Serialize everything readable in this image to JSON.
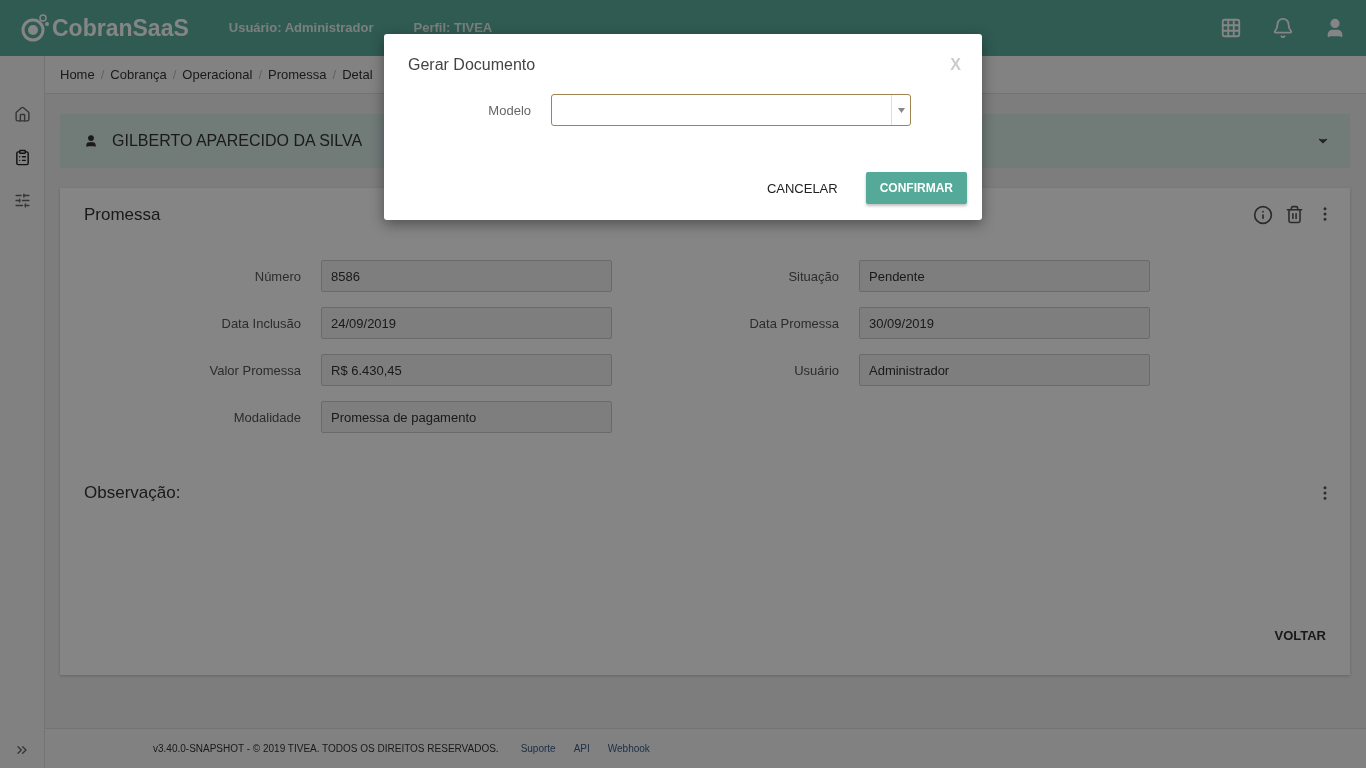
{
  "header": {
    "brand": "CobranSaaS",
    "user_label": "Usuário:",
    "user_value": "Administrador",
    "profile_label": "Perfil:",
    "profile_value": "TIVEA"
  },
  "breadcrumb": [
    "Home",
    "Cobrança",
    "Operacional",
    "Promessa",
    "Detal"
  ],
  "breadcrumb_separator": "/",
  "sidebar": {
    "items": [
      {
        "kind": "home",
        "selected": false
      },
      {
        "kind": "clipboard",
        "selected": true
      },
      {
        "kind": "sliders",
        "selected": false
      }
    ]
  },
  "person": {
    "name": "GILBERTO APARECIDO DA SILVA"
  },
  "card": {
    "title": "Promessa",
    "fields": [
      {
        "label": "Número",
        "value": "8586"
      },
      {
        "label": "Situação",
        "value": "Pendente"
      },
      {
        "label": "Data Inclusão",
        "value": "24/09/2019"
      },
      {
        "label": "Data Promessa",
        "value": "30/09/2019"
      },
      {
        "label": "Valor Promessa",
        "value": "R$ 6.430,45"
      },
      {
        "label": "Usuário",
        "value": "Administrador"
      },
      {
        "label": "Modalidade",
        "value": "Promessa de pagamento"
      }
    ],
    "observation_title": "Observação:",
    "back_button": "VOLTAR"
  },
  "footer": {
    "copyright": "v3.40.0-SNAPSHOT - © 2019 TIVEA. TODOS OS DIREITOS RESERVADOS.",
    "links": [
      "Suporte",
      "API",
      "Webhook"
    ]
  },
  "dialog": {
    "title": "Gerar Documento",
    "close": "X",
    "field_label": "Modelo",
    "cancel": "CANCELAR",
    "confirm": "CONFIRMAR"
  }
}
